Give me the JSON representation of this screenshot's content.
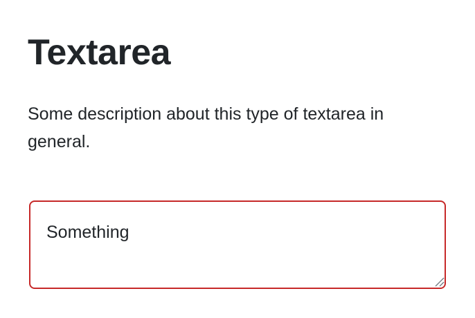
{
  "page": {
    "title": "Textarea",
    "description": "Some description about this type of textarea in general."
  },
  "textarea": {
    "value": "Something",
    "state": "error",
    "border_color": "#c62828"
  },
  "icons": {
    "resize_handle": "resize-grip-icon"
  },
  "colors": {
    "text": "#212529",
    "background": "#ffffff",
    "error_border": "#c62828"
  }
}
